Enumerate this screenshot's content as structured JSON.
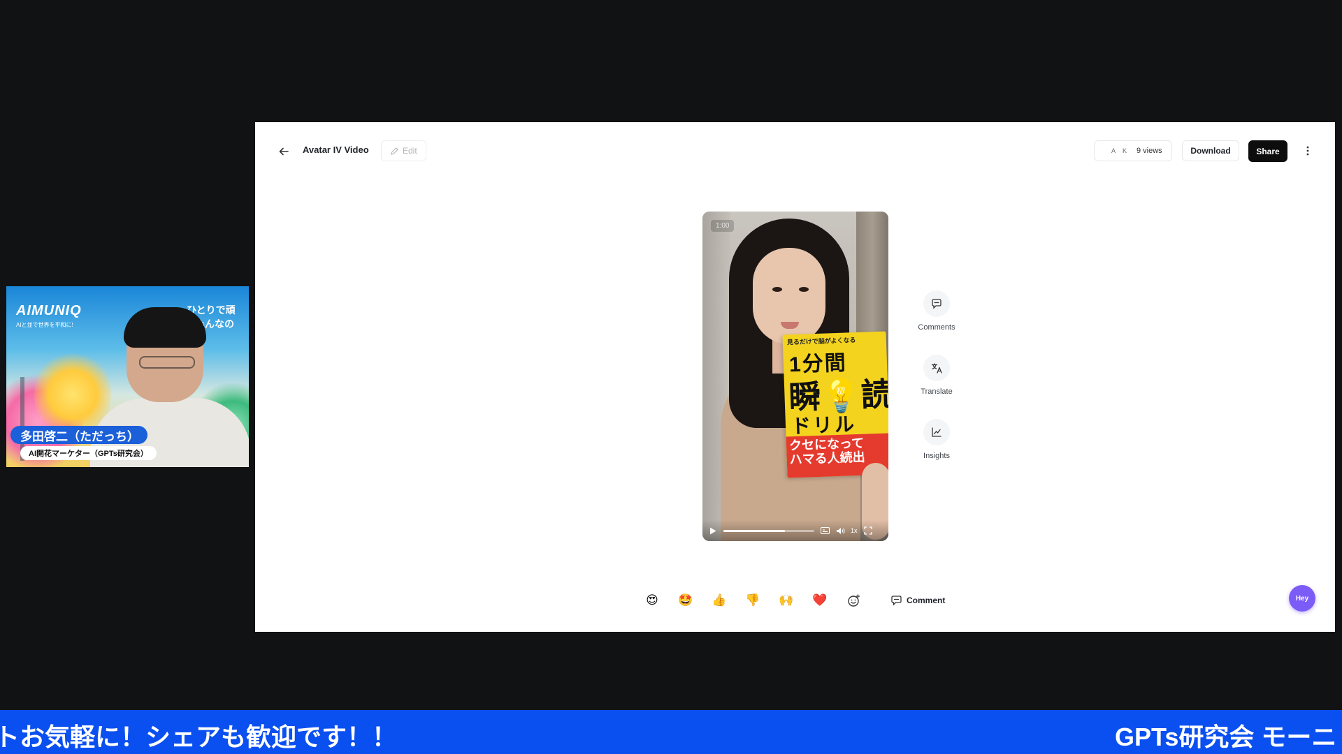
{
  "header": {
    "title": "Avatar IV Video",
    "edit_label": "Edit",
    "viewer_initials": [
      "A",
      "K"
    ],
    "views_label": "9 views",
    "download_label": "Download",
    "share_label": "Share",
    "more_icon": "more-vertical-icon",
    "back_icon": "arrow-left-icon"
  },
  "video": {
    "timestamp": "1:00",
    "progress_fraction": 0.68,
    "speed_label": "1x",
    "book": {
      "kicker": "見るだけで脳がよくなる",
      "line1": "1分間",
      "line2": "瞬💡読",
      "line3": "ドリル",
      "line4a": "クセになって",
      "line4b": "ハマる人続出"
    }
  },
  "side_actions": [
    {
      "label": "Comments",
      "icon": "comment-icon"
    },
    {
      "label": "Translate",
      "icon": "translate-icon"
    },
    {
      "label": "Insights",
      "icon": "chart-line-icon"
    }
  ],
  "reactions": [
    {
      "emoji": "😍",
      "name": "heart-eyes"
    },
    {
      "emoji": "🤩",
      "name": "star-struck"
    },
    {
      "emoji": "👍",
      "name": "thumbs-up"
    },
    {
      "emoji": "👎",
      "name": "thumbs-down"
    },
    {
      "emoji": "🙌",
      "name": "raised-hands"
    },
    {
      "emoji": "❤️",
      "name": "red-heart"
    }
  ],
  "comment_label": "Comment",
  "chat_bubble_label": "Hey",
  "webcam": {
    "logo": "AIMUNIQ",
    "tagline": "AIと並で世界を平和に!",
    "slogan1": "ひとりで頑",
    "slogan2": "みんなの",
    "name": "多田啓二（ただっち）",
    "role": "AI開花マーケター（GPTs研究会）"
  },
  "ticker": {
    "left_text": "トお気軽に！シェアも歓迎です！！",
    "right_text": "GPTs研究会 モーニ"
  },
  "colors": {
    "accent_dark": "#0d0d0d",
    "chat_purple": "#7c5cf6",
    "ticker_blue": "#0a4ff0",
    "name_badge_blue": "#1b5fd9"
  }
}
